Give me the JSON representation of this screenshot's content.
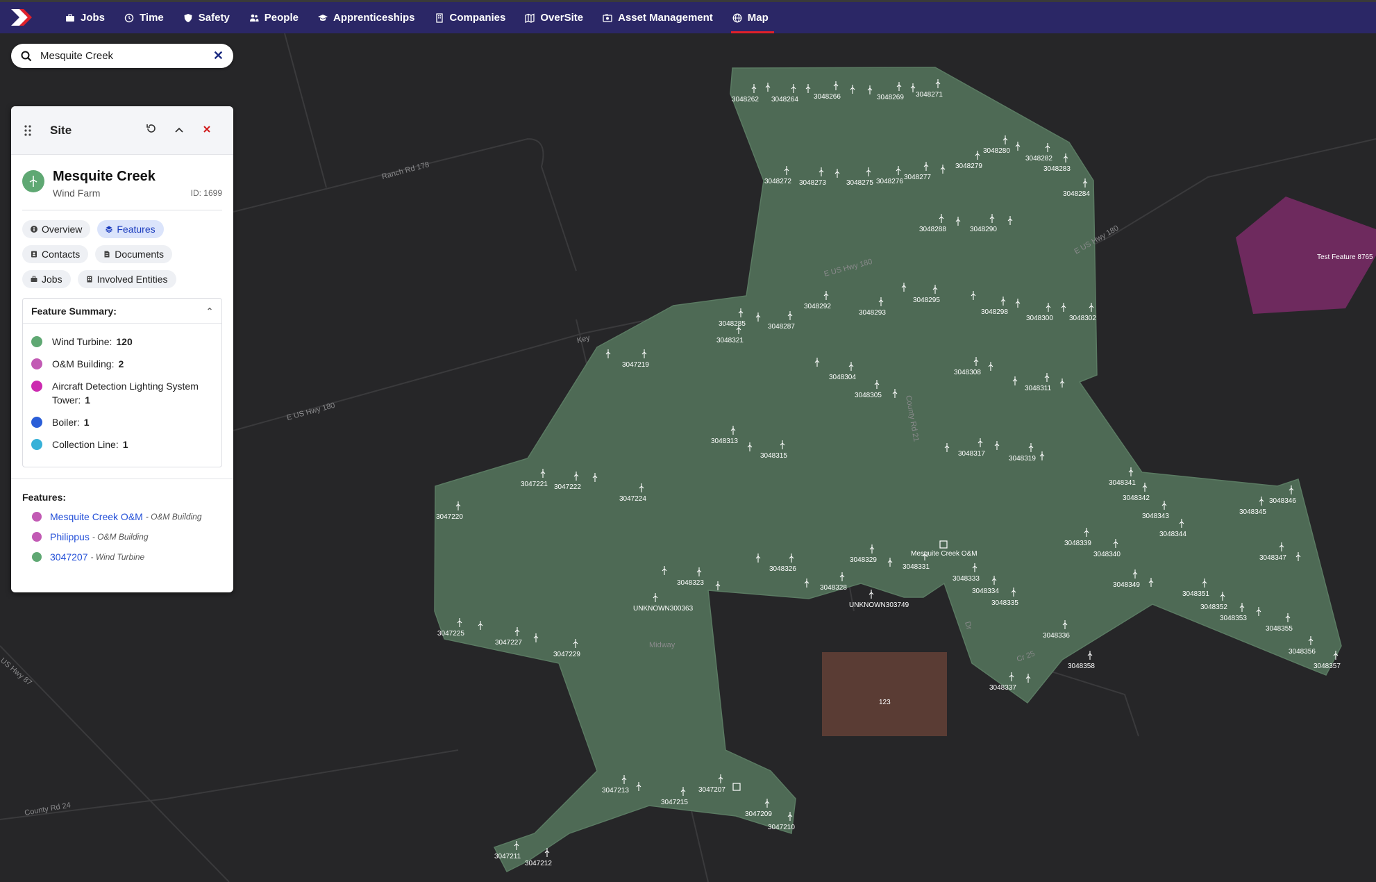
{
  "nav": {
    "items": [
      {
        "label": "Jobs"
      },
      {
        "label": "Time"
      },
      {
        "label": "Safety"
      },
      {
        "label": "People"
      },
      {
        "label": "Apprenticeships"
      },
      {
        "label": "Companies"
      },
      {
        "label": "OverSite"
      },
      {
        "label": "Asset Management"
      },
      {
        "label": "Map"
      }
    ],
    "active": "Map"
  },
  "search": {
    "value": "Mesquite Creek",
    "clear": "✕"
  },
  "panel": {
    "title": "Site",
    "site_name": "Mesquite Creek",
    "site_type": "Wind Farm",
    "site_id": "ID: 1699",
    "tabs": [
      {
        "label": "Overview"
      },
      {
        "label": "Features"
      },
      {
        "label": "Contacts"
      },
      {
        "label": "Documents"
      },
      {
        "label": "Jobs"
      },
      {
        "label": "Involved Entities"
      }
    ],
    "active_tab": "Features",
    "summary_title": "Feature Summary:",
    "summary": [
      {
        "label": "Wind Turbine:",
        "count": "120",
        "color": "#5fa873"
      },
      {
        "label": "O&M Building:",
        "count": "2",
        "color": "#c25ab4"
      },
      {
        "label": "Aircraft Detection Lighting System Tower:",
        "count": "1",
        "color": "#cc2ab0"
      },
      {
        "label": "Boiler:",
        "count": "1",
        "color": "#2a5ed8"
      },
      {
        "label": "Collection Line:",
        "count": "1",
        "color": "#37b1d8"
      }
    ],
    "features_title": "Features:",
    "features": [
      {
        "name": "Mesquite Creek O&M",
        "type": "- O&M Building",
        "color": "#c25ab4"
      },
      {
        "name": "Philippus",
        "type": "- O&M Building",
        "color": "#c25ab4"
      },
      {
        "name": "3047207",
        "type": "- Wind Turbine",
        "color": "#5fa873"
      }
    ]
  },
  "map": {
    "roads": [
      "Ranch Rd 178",
      "E US Hwy 180",
      "E US Hwy 180",
      "E US Hwy 180",
      "County Rd 24",
      "US Hwy 87",
      "County Rd 21",
      "Key",
      "Midway",
      "Cr 25",
      "Dr"
    ],
    "zones": [
      {
        "label": "Test Feature 8765",
        "color": "#6e2a5e"
      },
      {
        "label": "123",
        "color": "#5a3c34"
      }
    ],
    "site_label": "Mesquite Creek O&M",
    "turbines": [
      "3048262",
      "3048264",
      "3048266",
      "3048269",
      "3048271",
      "3048272",
      "3048273",
      "3048275",
      "3048276",
      "3048277",
      "3048279",
      "3048280",
      "3048282",
      "3048283",
      "3048284",
      "3048288",
      "3048290",
      "3048285",
      "3048287",
      "3048292",
      "3048293",
      "3048295",
      "3048298",
      "3048300",
      "3048302",
      "3048321",
      "3047219",
      "3048304",
      "3048305",
      "3048308",
      "3048311",
      "3048313",
      "3048315",
      "3048317",
      "3048319",
      "3047221",
      "3047222",
      "3047224",
      "3047220",
      "3048341",
      "3048342",
      "3048343",
      "3048344",
      "3048345",
      "3048346",
      "3048339",
      "3048340",
      "3048347",
      "3048329",
      "3048326",
      "3048331",
      "3048323",
      "3048328",
      "3048333",
      "3048334",
      "3048335",
      "3048349",
      "3048351",
      "3048352",
      "3048353",
      "3048355",
      "3048356",
      "3048357",
      "3047225",
      "3047227",
      "3047229",
      "3048336",
      "3048358",
      "3048337",
      "3047213",
      "3047215",
      "3047207",
      "3047209",
      "3047210",
      "3047211",
      "3047212",
      "UNKNOWN300363",
      "UNKNOWN303749"
    ]
  }
}
